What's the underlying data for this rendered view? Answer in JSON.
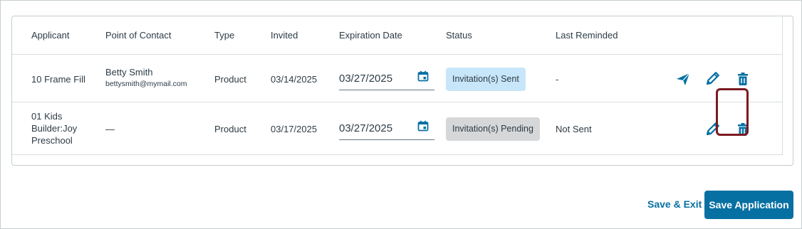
{
  "table": {
    "headers": {
      "applicant": "Applicant",
      "contact": "Point of Contact",
      "type": "Type",
      "invited": "Invited",
      "expiration": "Expiration Date",
      "status": "Status",
      "last_reminded": "Last Reminded"
    },
    "rows": [
      {
        "applicant": "10 Frame Fill",
        "contact_name": "Betty Smith",
        "contact_email": "bettysmith@mymail.com",
        "type": "Product",
        "invited": "03/14/2025",
        "expiration": "03/27/2025",
        "status": "Invitation(s) Sent",
        "last_reminded": "-"
      },
      {
        "applicant_lines": [
          "01 Kids",
          "Builder:Joy",
          "Preschool"
        ],
        "contact": "—",
        "type": "Product",
        "invited": "03/17/2025",
        "expiration": "03/27/2025",
        "status": "Invitation(s) Pending",
        "last_reminded": "Not Sent"
      }
    ]
  },
  "footer": {
    "save_exit": "Save & Exit",
    "save_application": "Save Application"
  },
  "colors": {
    "accent": "#0770a3",
    "badge_sent": "#c8e6f9",
    "badge_pending": "#d5d7d9",
    "highlight": "#7a1a22"
  },
  "icons": [
    "calendar-icon",
    "send-icon",
    "pencil-icon",
    "trash-icon"
  ]
}
